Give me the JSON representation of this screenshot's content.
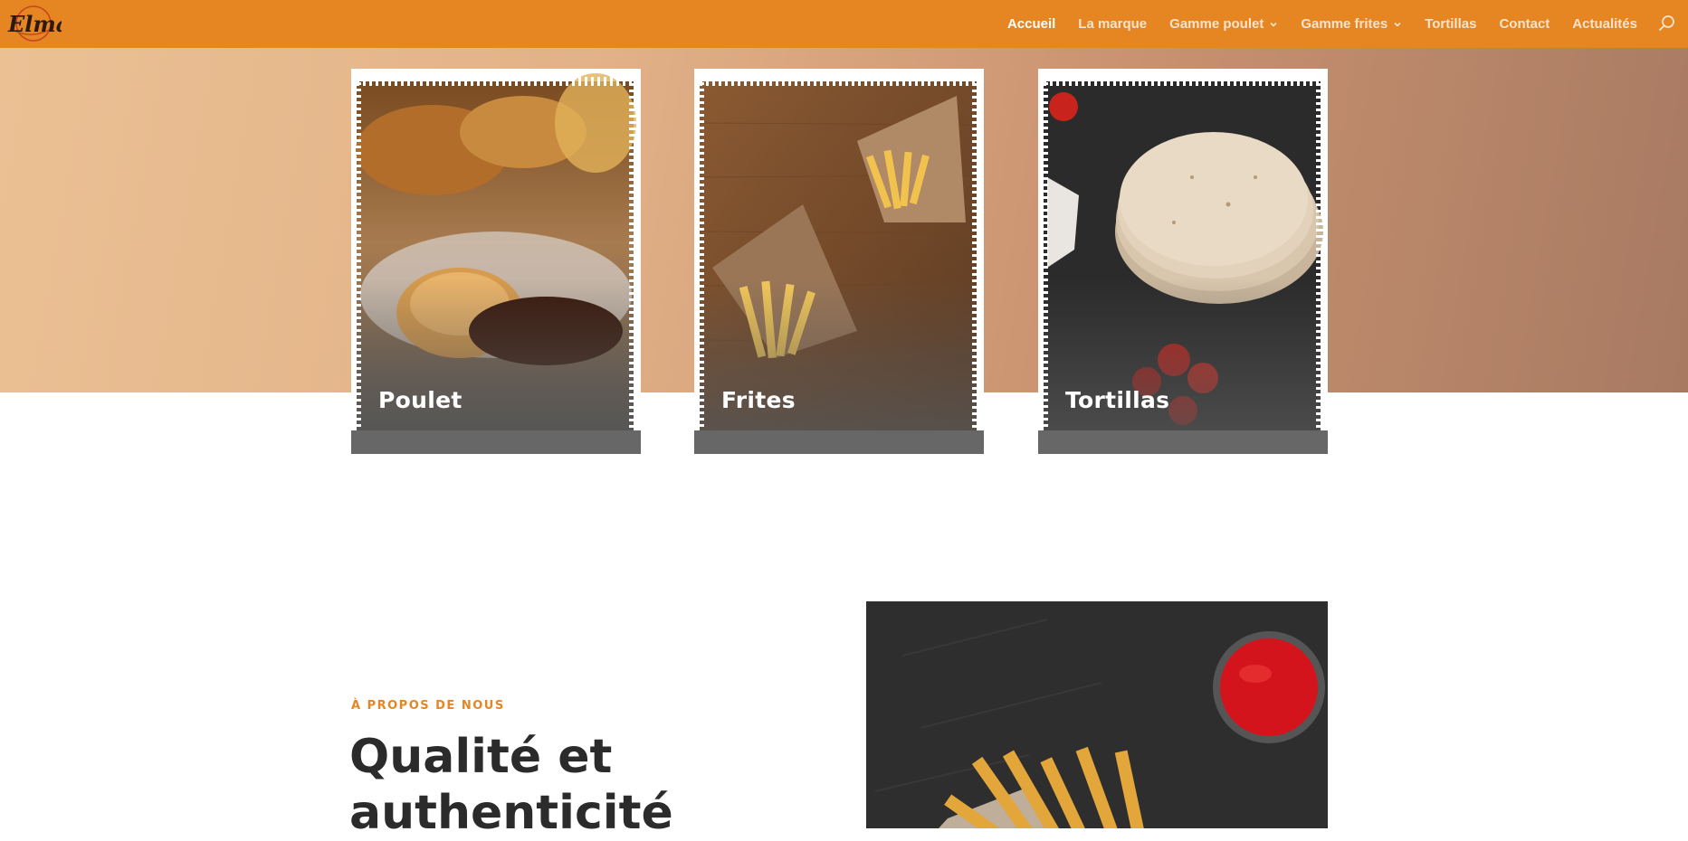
{
  "header": {
    "logo_text": "Elma",
    "background": "#e68623",
    "nav": [
      {
        "label": "Accueil",
        "active": true,
        "has_dropdown": false
      },
      {
        "label": "La marque",
        "active": false,
        "has_dropdown": false
      },
      {
        "label": "Gamme poulet",
        "active": false,
        "has_dropdown": true
      },
      {
        "label": "Gamme frites",
        "active": false,
        "has_dropdown": true
      },
      {
        "label": "Tortillas",
        "active": false,
        "has_dropdown": false
      },
      {
        "label": "Contact",
        "active": false,
        "has_dropdown": false
      },
      {
        "label": "Actualités",
        "active": false,
        "has_dropdown": false
      }
    ],
    "search_icon": "search-icon"
  },
  "categories": [
    {
      "label": "Poulet",
      "image": "fried-chicken-photo"
    },
    {
      "label": "Frites",
      "image": "french-fries-cones-photo"
    },
    {
      "label": "Tortillas",
      "image": "tortillas-stack-photo"
    }
  ],
  "about": {
    "kicker": "À PROPOS DE NOUS",
    "title": "Qualité et authenticité",
    "image": "fries-with-ketchup-photo"
  },
  "colors": {
    "accent": "#e68623",
    "nav_text": "#fbe3cc",
    "heading": "#2b2b2b"
  }
}
